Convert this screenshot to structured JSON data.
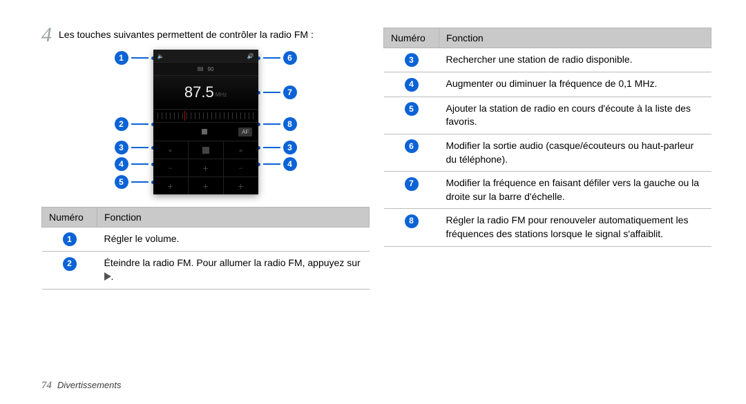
{
  "step": {
    "number": "4",
    "text": "Les touches suivantes permettent de contrôler la radio FM :"
  },
  "radio": {
    "volume_icon": "🔈",
    "speaker_icon": "🔊",
    "preset_1": "88",
    "preset_2": "90",
    "frequency": "87.5",
    "unit": "MHz",
    "af_label": "AF",
    "seek_left": "«",
    "seek_right": "»"
  },
  "callouts": {
    "c1": "1",
    "c2": "2",
    "c3": "3",
    "c4": "4",
    "c5": "5",
    "c6": "6",
    "c7": "7",
    "c8": "8"
  },
  "table1": {
    "head_num": "Numéro",
    "head_fn": "Fonction",
    "rows": [
      {
        "n": "1",
        "fn": "Régler le volume."
      },
      {
        "n": "2",
        "fn_prefix": "Éteindre la radio FM. Pour allumer la radio FM, appuyez sur ",
        "has_play": true,
        "fn_suffix": "."
      }
    ]
  },
  "table2": {
    "head_num": "Numéro",
    "head_fn": "Fonction",
    "rows": [
      {
        "n": "3",
        "fn": "Rechercher une station de radio disponible."
      },
      {
        "n": "4",
        "fn": "Augmenter ou diminuer la fréquence de 0,1 MHz."
      },
      {
        "n": "5",
        "fn": "Ajouter la station de radio en cours d'écoute à la liste des favoris."
      },
      {
        "n": "6",
        "fn": "Modifier la sortie audio (casque/écouteurs ou haut-parleur du téléphone)."
      },
      {
        "n": "7",
        "fn": "Modifier la fréquence en faisant défiler vers la gauche ou la droite sur la barre d'échelle."
      },
      {
        "n": "8",
        "fn": "Régler la radio FM pour renouveler automatiquement les fréquences des stations lorsque le signal s'affaiblit."
      }
    ]
  },
  "footer": {
    "page": "74",
    "section": "Divertissements"
  }
}
